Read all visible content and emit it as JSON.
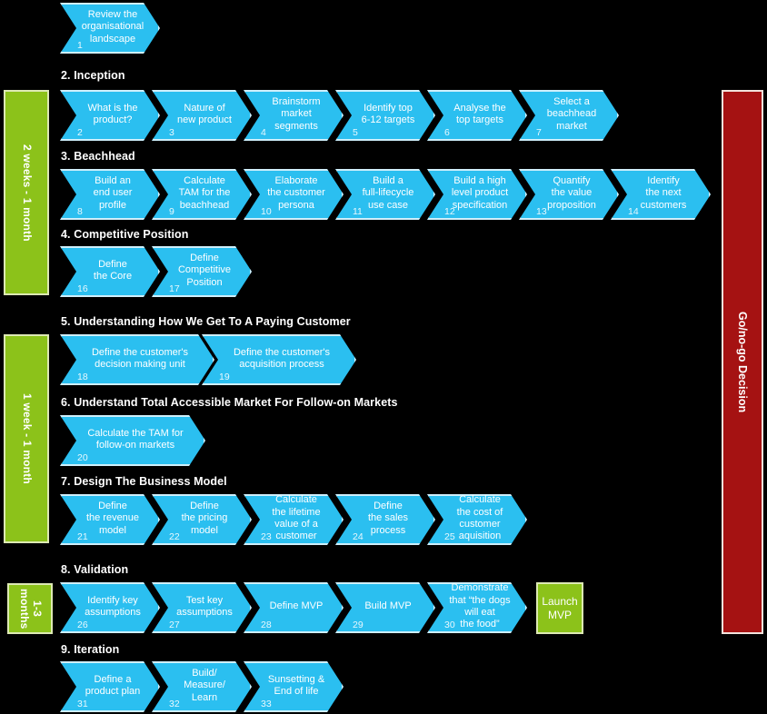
{
  "phases": [
    {
      "label": "2 weeks - 1 month",
      "id": "2-weeks-1-month"
    },
    {
      "label": "1 week - 1 month",
      "id": "1-week-1-month"
    },
    {
      "label": "1-3\nmonths",
      "id": "1-3-months"
    }
  ],
  "decision": {
    "label": "Go/no-go Decision"
  },
  "launch": {
    "label": "Launch\nMVP"
  },
  "colors": {
    "background": "#000000",
    "chevron_fill": "#2BBFF0",
    "chevron_border": "#CFEFFB",
    "phase_fill": "#8CC21A",
    "phase_border": "#DDE9B4",
    "decision_fill": "#A51212",
    "decision_border": "#F2E2DC",
    "text": "#FFFFFF"
  },
  "sections": [
    {
      "id": "section-review",
      "title": "",
      "steps": [
        {
          "num": "1",
          "label": "Review the\norganisational\nlandscape"
        }
      ]
    },
    {
      "id": "section-inception",
      "title": "2. Inception",
      "steps": [
        {
          "num": "2",
          "label": "What is the\nproduct?"
        },
        {
          "num": "3",
          "label": "Nature of\nnew product"
        },
        {
          "num": "4",
          "label": "Brainstorm\nmarket\nsegments"
        },
        {
          "num": "5",
          "label": "Identify top\n6-12 targets"
        },
        {
          "num": "6",
          "label": "Analyse the\ntop targets"
        },
        {
          "num": "7",
          "label": "Select a\nbeachhead\nmarket"
        }
      ]
    },
    {
      "id": "section-beachhead",
      "title": "3. Beachhead",
      "steps": [
        {
          "num": "8",
          "label": "Build an\nend user\nprofile"
        },
        {
          "num": "9",
          "label": "Calculate\nTAM for the\nbeachhead"
        },
        {
          "num": "10",
          "label": "Elaborate\nthe customer\npersona"
        },
        {
          "num": "11",
          "label": "Build a\nfull-lifecycle\nuse case"
        },
        {
          "num": "12",
          "label": "Build a high\nlevel product\nspecification"
        },
        {
          "num": "13",
          "label": "Quantify\nthe value\nproposition"
        },
        {
          "num": "14",
          "label": "Identify\nthe next\ncustomers"
        }
      ]
    },
    {
      "id": "section-competitive-position",
      "title": "4. Competitive Position",
      "steps": [
        {
          "num": "16",
          "label": "Define\nthe Core"
        },
        {
          "num": "17",
          "label": "Define\nCompetitive\nPosition"
        }
      ]
    },
    {
      "id": "section-paying-customer",
      "title": "5. Understanding How We Get To A Paying Customer",
      "steps": [
        {
          "num": "18",
          "label": "Define the customer's\ndecision making unit"
        },
        {
          "num": "19",
          "label": "Define the customer's\nacquisition process"
        }
      ]
    },
    {
      "id": "section-follow-on-markets",
      "title": "6. Understand Total Accessible Market For Follow-on Markets",
      "steps": [
        {
          "num": "20",
          "label": "Calculate the TAM for\nfollow-on markets"
        }
      ]
    },
    {
      "id": "section-business-model",
      "title": "7. Design The Business Model",
      "steps": [
        {
          "num": "21",
          "label": "Define\nthe revenue\nmodel"
        },
        {
          "num": "22",
          "label": "Define\nthe pricing\nmodel"
        },
        {
          "num": "23",
          "label": "Calculate\nthe lifetime\nvalue of a\ncustomer"
        },
        {
          "num": "24",
          "label": "Define\nthe sales\nprocess"
        },
        {
          "num": "25",
          "label": "Calculate\nthe cost of\ncustomer\naquisition"
        }
      ]
    },
    {
      "id": "section-validation",
      "title": "8. Validation",
      "steps": [
        {
          "num": "26",
          "label": "Identify key\nassumptions"
        },
        {
          "num": "27",
          "label": "Test key\nassumptions"
        },
        {
          "num": "28",
          "label": "Define MVP"
        },
        {
          "num": "29",
          "label": "Build MVP"
        },
        {
          "num": "30",
          "label": "Demonstrate\nthat “the dogs\nwill eat\nthe food”"
        }
      ]
    },
    {
      "id": "section-iteration",
      "title": "9. Iteration",
      "steps": [
        {
          "num": "31",
          "label": "Define a\nproduct plan"
        },
        {
          "num": "32",
          "label": "Build/\nMeasure/\nLearn"
        },
        {
          "num": "33",
          "label": "Sunsetting &\nEnd of life"
        }
      ]
    }
  ]
}
